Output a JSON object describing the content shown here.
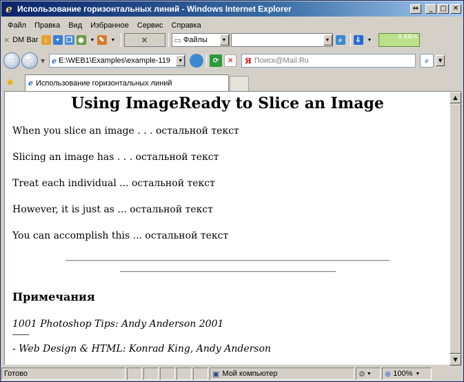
{
  "window": {
    "title": "Использование горизонтальных линий - Windows Internet Explorer",
    "buttons": {
      "restore": "↔",
      "minimize": "_",
      "maximize": "□",
      "close": "✕"
    }
  },
  "menu": [
    "Файл",
    "Правка",
    "Вид",
    "Избранное",
    "Сервис",
    "Справка"
  ],
  "toolbar": {
    "dm_bar": "DM Bar",
    "files_label": "Файлы",
    "kb_status": "0 KB/s"
  },
  "address": {
    "url": "E:\\WEB1\\Examples\\example-119",
    "search_placeholder": "Поиск@Mail.Ru"
  },
  "tabs": [
    {
      "label": "Использование горизонтальных линий"
    }
  ],
  "page": {
    "heading": "Using ImageReady to Slice an Image",
    "paragraphs": [
      "When you slice an image . . . остальной текст",
      "Slicing an image has . . . остальной текст",
      "Treat each individual ... остальной текст",
      "However, it is just as ... остальной текст",
      "You can accomplish this ... остальной текст"
    ],
    "notes_heading": "Примечания",
    "note1": "1001 Photoshop Tips: Andy Anderson 2001",
    "note2": "- Web Design & HTML: Konrad King, Andy Anderson"
  },
  "status": {
    "text": "Готово",
    "zone": "Мой компьютер",
    "zoom": "100%"
  },
  "colors": {
    "titlebar_start": "#0a246a",
    "titlebar_end": "#a6caf0",
    "kb_indicator": "#b9e08b"
  }
}
